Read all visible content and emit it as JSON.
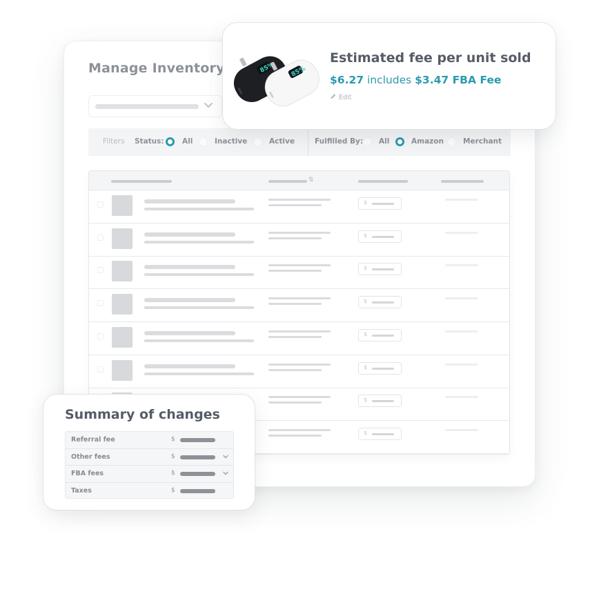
{
  "inventory": {
    "title": "Manage Inventory",
    "filters": {
      "label": "Filters",
      "status": {
        "label": "Status:",
        "options": [
          {
            "label": "All",
            "selected": true
          },
          {
            "label": "Inactive",
            "selected": false
          },
          {
            "label": "Active",
            "selected": false
          }
        ]
      },
      "fulfilled_by": {
        "label": "Fulfilled By:",
        "options": [
          {
            "label": "All",
            "selected": false
          },
          {
            "label": "Amazon",
            "selected": true
          },
          {
            "label": "Merchant",
            "selected": false
          }
        ]
      }
    },
    "table": {
      "row_count": 8,
      "currency_symbol": "$",
      "sort_icon": "⇅"
    }
  },
  "fee_card": {
    "title": "Estimated fee per unit sold",
    "total_fee": "$6.27",
    "includes_text": "includes",
    "fba_fee": "$3.47 FBA Fee",
    "edit_label": "Edit",
    "product_image": "two portable power banks (black and white) with digital display"
  },
  "summary": {
    "title": "Summary of changes",
    "currency_symbol": "$",
    "rows": [
      {
        "label": "Referral fee",
        "expandable": false
      },
      {
        "label": "Other fees",
        "expandable": true
      },
      {
        "label": "FBA fees",
        "expandable": true
      },
      {
        "label": "Taxes",
        "expandable": false
      }
    ]
  },
  "colors": {
    "accent": "#2a9aae",
    "heading": "#565c66"
  }
}
